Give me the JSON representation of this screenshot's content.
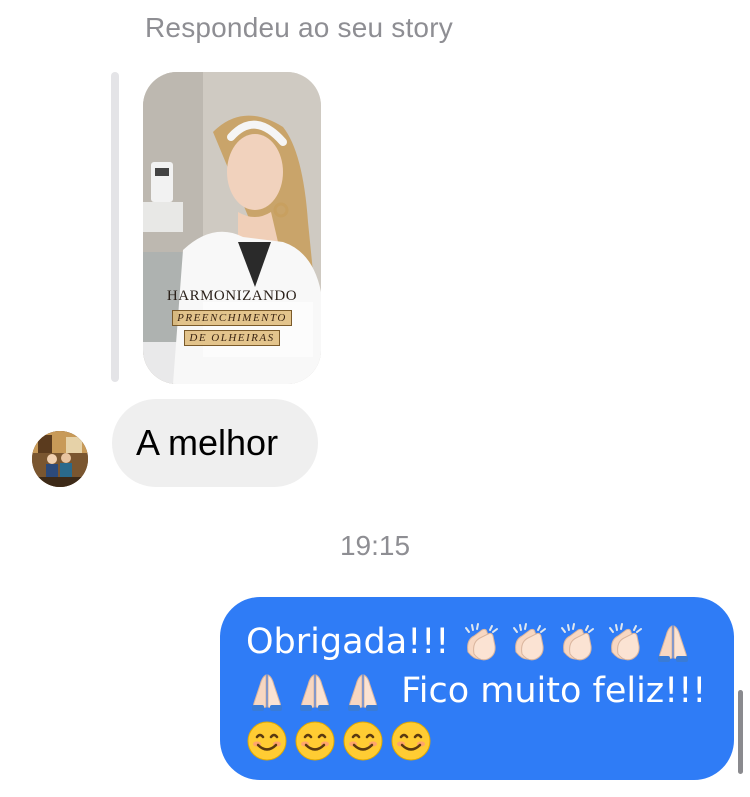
{
  "reply": {
    "header": "Respondeu ao seu story",
    "story": {
      "title": "HARMONIZANDO",
      "line1": "PREENCHIMENTO",
      "line2": "DE OLHEIRAS"
    }
  },
  "incoming": {
    "text": "A melhor"
  },
  "timestamp": "19:15",
  "outgoing": {
    "line1_text": "Obrigada!!!",
    "line1_emojis": [
      "clapping-hands",
      "clapping-hands",
      "clapping-hands",
      "clapping-hands",
      "folded-hands"
    ],
    "line2_emojis": [
      "folded-hands",
      "folded-hands",
      "folded-hands"
    ],
    "line2_text": "Fico muito feliz!!!",
    "line3_emojis": [
      "smiling-face",
      "smiling-face",
      "smiling-face",
      "smiling-face"
    ]
  },
  "colors": {
    "outgoing_bubble": "#2f7cf6",
    "incoming_bubble": "#efefef",
    "meta_text": "#8e8e93",
    "reply_bar": "#e4e4e7"
  }
}
